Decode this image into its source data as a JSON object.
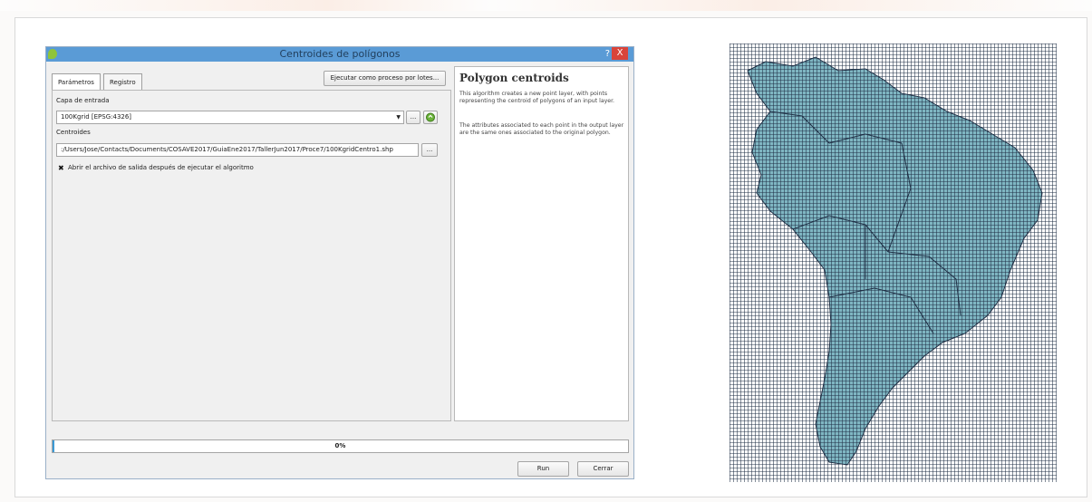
{
  "dialog": {
    "title": "Centroides de polígonos",
    "help_button": "?",
    "close_button": "X",
    "tabs": [
      {
        "label": "Parámetros",
        "active": true
      },
      {
        "label": "Registro",
        "active": false
      }
    ],
    "batch_button": "Ejecutar como proceso por lotes...",
    "input_layer_label": "Capa de entrada",
    "input_layer_value": "100Kgrid [EPSG:4326]",
    "browse_button": "...",
    "output_label": "Centroides",
    "output_value": ":/Users/Jose/Contacts/Documents/COSAVE2017/GuiaEne2017/TallerJun2017/Proce7/100KgridCentro1.shp",
    "open_output_checkbox": {
      "label": "Abrir el archivo de salida después de ejecutar el algoritmo",
      "checked": true
    },
    "help": {
      "title": "Polygon centroids",
      "paragraph1": "This algorithm creates a new point layer, with points representing the centroid of polygons of an input layer.",
      "paragraph2": "The attributes associated to each point in the output layer are the same ones associated to the original polygon."
    },
    "progress": {
      "value": 0,
      "label": "0%"
    },
    "run_button": "Run",
    "cancel_button": "Cerrar"
  },
  "map": {
    "land_color": "#7fb6c2",
    "sea_color": "#ffffff",
    "grid_color": "#1f2f45"
  }
}
